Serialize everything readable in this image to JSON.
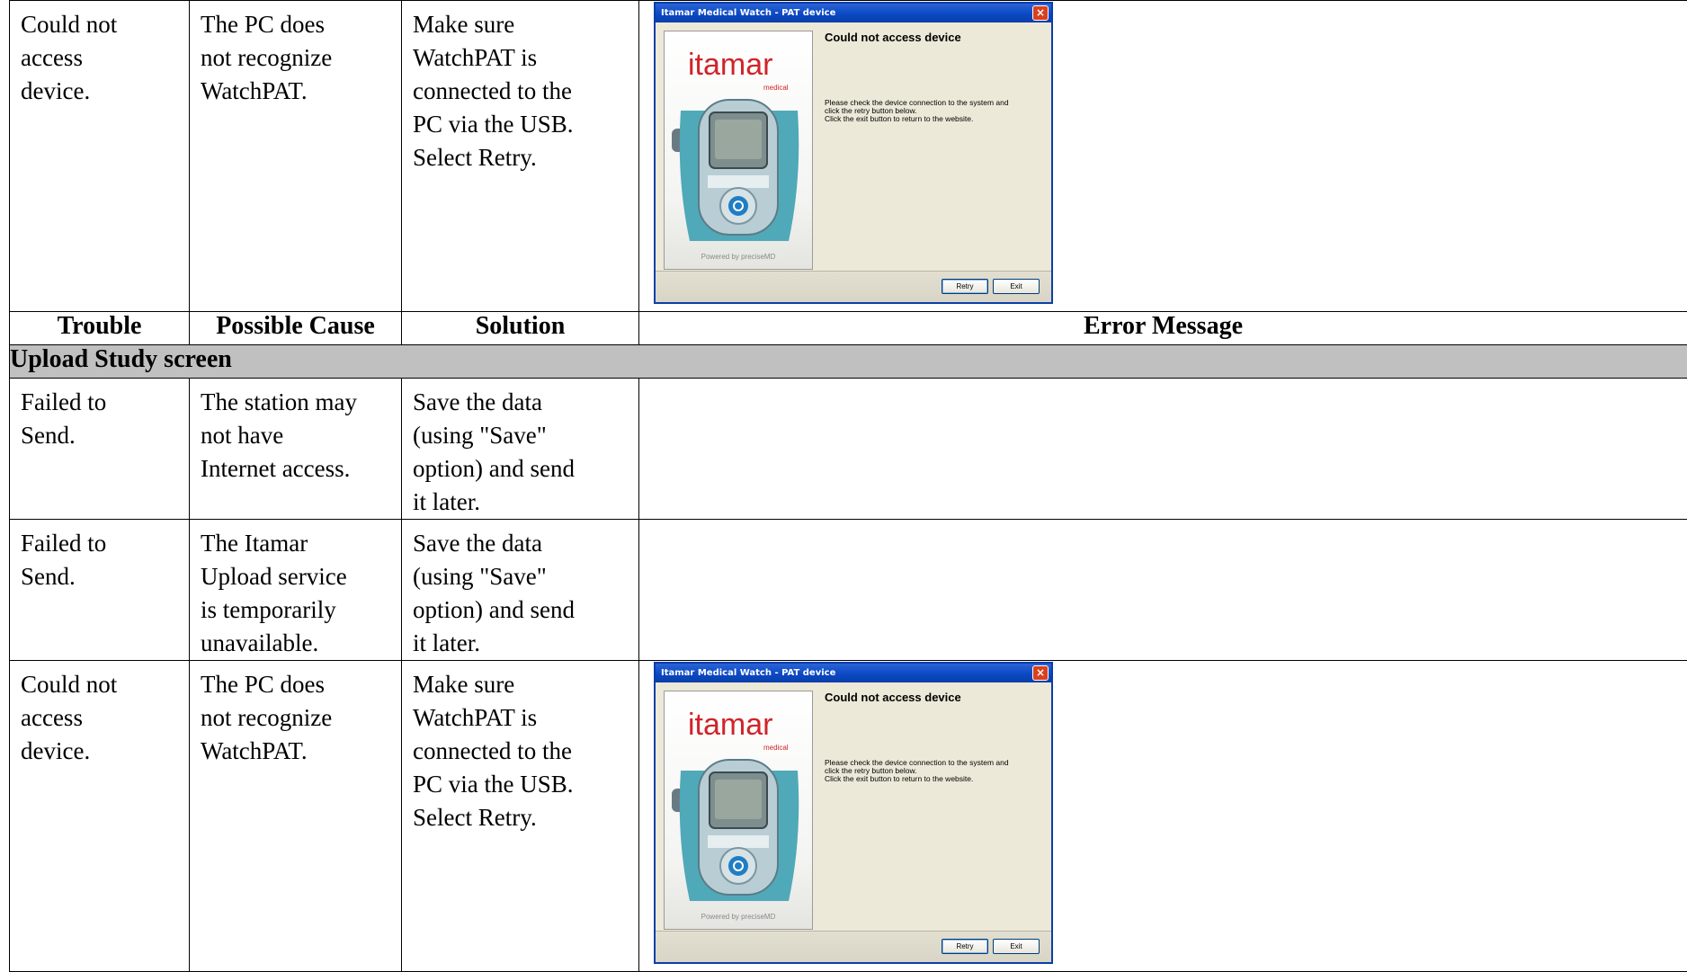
{
  "headers": {
    "trouble": "Trouble",
    "cause": "Possible Cause",
    "solution": "Solution",
    "error": "Error Message"
  },
  "section_upload": "Upload Study screen",
  "rows": [
    {
      "trouble": "Could not\naccess\ndevice.",
      "cause": "The PC does\nnot recognize\nWatchPAT.",
      "solution": "Make sure\nWatchPAT is\nconnected to the\nPC via the USB.\nSelect Retry."
    },
    {
      "trouble": "Failed to\nSend.",
      "cause": "The station may\nnot have\nInternet access.",
      "solution": "Save the data\n(using \"Save\"\noption) and send\nit later."
    },
    {
      "trouble": "Failed to\nSend.",
      "cause": "The Itamar\nUpload service\nis temporarily\nunavailable.",
      "solution": "Save the data\n(using \"Save\"\noption) and send\nit later."
    },
    {
      "trouble": "Could not\naccess\ndevice.",
      "cause": "The PC does\nnot recognize\nWatchPAT.",
      "solution": "Make sure\nWatchPAT is\nconnected to the\nPC via the USB.\nSelect Retry."
    }
  ],
  "dialog": {
    "title": "Itamar Medical Watch - PAT device",
    "close": "×",
    "logo": "itamar",
    "logo_sub": "medical",
    "powered": "Powered by preciseMD",
    "message_title": "Could not access device",
    "message_body": "Please check the device connection to the system and\nclick the retry button below.\nClick the exit button to return to the website.",
    "retry": "Retry",
    "exit": "Exit"
  },
  "colors": {
    "section_bg": "#c0c0c0",
    "titlebar": "#0a47c2",
    "logo_red": "#d0242a",
    "dialog_bg": "#ece9d8"
  }
}
